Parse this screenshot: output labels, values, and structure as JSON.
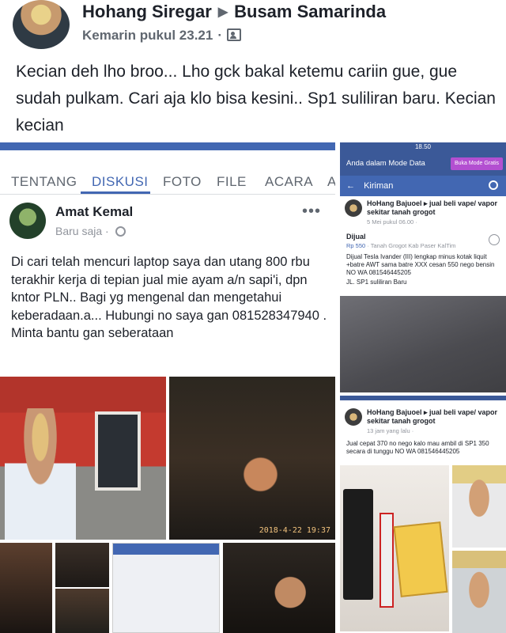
{
  "post": {
    "author": "Hohang Siregar",
    "target": "Busam Samarinda",
    "time": "Kemarin pukul 23.21",
    "text": "Kecian deh lho broo...  Lho gck bakal ketemu cariin gue, gue sudah pulkam.  Cari aja klo bisa kesini.. Sp1 suliliran baru.  Kecian kecian"
  },
  "group_screenshot": {
    "tabs": [
      "TENTANG",
      "DISKUSI",
      "FOTO",
      "FILE",
      "ACARA",
      "A"
    ],
    "active_tab": "DISKUSI",
    "author": "Amat Kemal",
    "time": "Baru saja",
    "more": "•••",
    "body": "Di cari telah mencuri laptop saya dan utang 800 rbu terakhir kerja di tepian jual mie ayam a/n sapi'i, dpn kntor PLN.. Bagi yg mengenal dan mengetahui keberadaan.a... Hubungi no saya gan 081528347940 .  Minta bantu gan seberataan",
    "photo_date": "2018-4-22 19:37"
  },
  "phone_1": {
    "status_time": "18.50",
    "mode_text": "Anda dalam Mode Data",
    "mode_button": "Buka Mode Gratis",
    "header": "Kiriman",
    "poster": "HoHang Bajuoel ▸ jual beli vape/ vapor sekitar tanah grogot",
    "time": "5 Mei pukul 06.00 ·",
    "label": "Dijual",
    "price": "Rp 550",
    "location": "· Tanah Grogot Kab Paser KalTim",
    "desc": "Dijual Tesla Ivander (III) lengkap minus kotak liquit +batre AWT sama batre XXX cesan 550 nego bensin NO WA 081546445205",
    "address": "JL. SP1 suliliran Baru"
  },
  "phone_2": {
    "poster": "HoHang Bajuoel ▸ jual beli vape/ vapor sekitar tanah grogot",
    "time": "13 jam yang lalu ·",
    "desc": "Jual cepat 370 no nego kalo mau ambil di SP1 350 secara di tunggu NO WA 081546445205"
  },
  "colors": {
    "facebook_blue": "#4267b2",
    "text_dark": "#1d2129",
    "text_muted": "#606770"
  }
}
